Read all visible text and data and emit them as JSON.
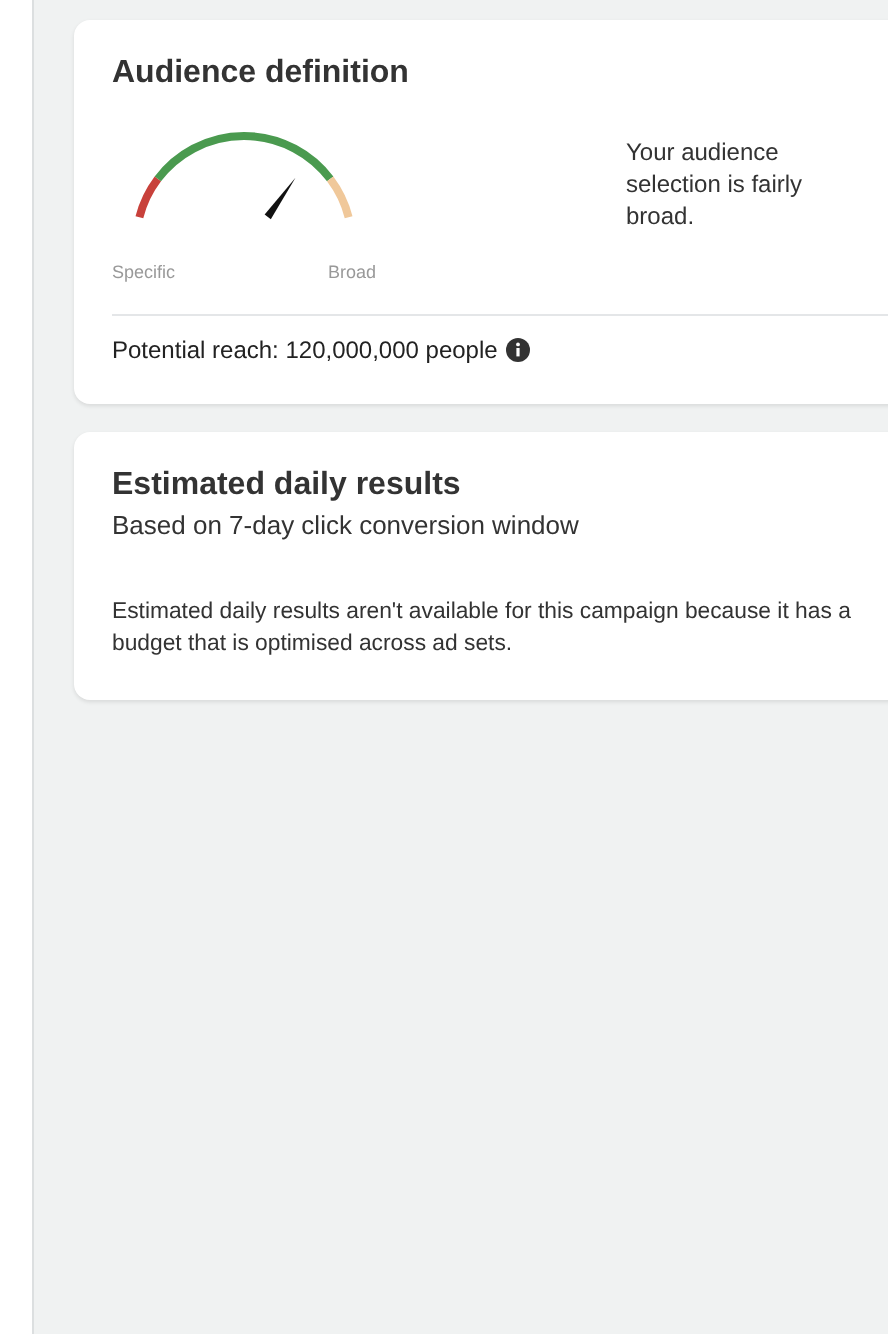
{
  "audience_definition": {
    "title": "Audience definition",
    "gauge": {
      "level": 0.75,
      "min_label": "Specific",
      "max_label": "Broad"
    },
    "description": "Your audience selection is fairly broad.",
    "potential_reach": "Potential reach: 120,000,000 people"
  },
  "estimated_daily_results": {
    "title": "Estimated daily results",
    "subtitle": "Based on 7-day click conversion window",
    "message": "Estimated daily results aren't available for this campaign because it has a budget that is optimised across ad sets."
  }
}
